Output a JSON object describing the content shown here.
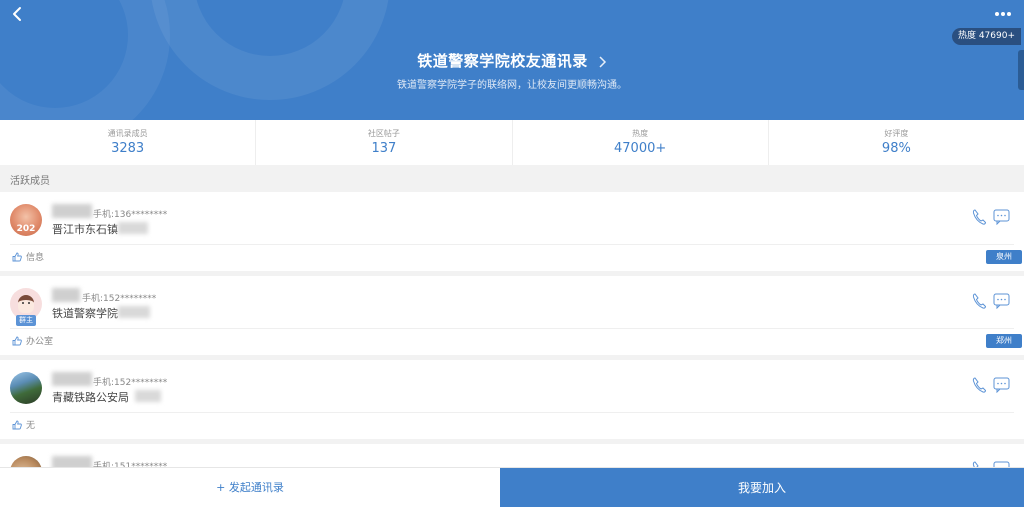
{
  "header": {
    "title": "铁道警察学院校友通讯录",
    "subtitle": "铁道警察学院学子的联络网，让校友间更顺畅沟通。",
    "hot_badge": "热度 47690+",
    "bg_color": "#3f7fc9"
  },
  "stats": [
    {
      "label": "通讯录成员",
      "value": "3283"
    },
    {
      "label": "社区帖子",
      "value": "137"
    },
    {
      "label": "热度",
      "value": "47000+"
    },
    {
      "label": "好评度",
      "value": "98%"
    }
  ],
  "section_label": "活跃成员",
  "members": [
    {
      "phone": "手机:136********",
      "org": "晋江市东石镇",
      "tag": "信息",
      "city": "泉州",
      "is_owner": false,
      "owner_label": ""
    },
    {
      "phone": "手机:152********",
      "org": "铁道警察学院",
      "tag": "办公室",
      "city": "郑州",
      "is_owner": true,
      "owner_label": "群主"
    },
    {
      "phone": "手机:152********",
      "org": "青藏铁路公安局",
      "tag": "无",
      "city": "",
      "is_owner": false,
      "owner_label": ""
    },
    {
      "phone": "手机:151********",
      "org": "",
      "tag": "",
      "city": "",
      "is_owner": false,
      "owner_label": ""
    }
  ],
  "footer": {
    "start_label": "+ 发起通讯录",
    "join_label": "我要加入"
  },
  "icons": {
    "back": "back-chevron-icon",
    "more": "more-dots-icon",
    "call": "phone-icon",
    "message": "message-icon",
    "like": "thumbs-up-icon"
  }
}
